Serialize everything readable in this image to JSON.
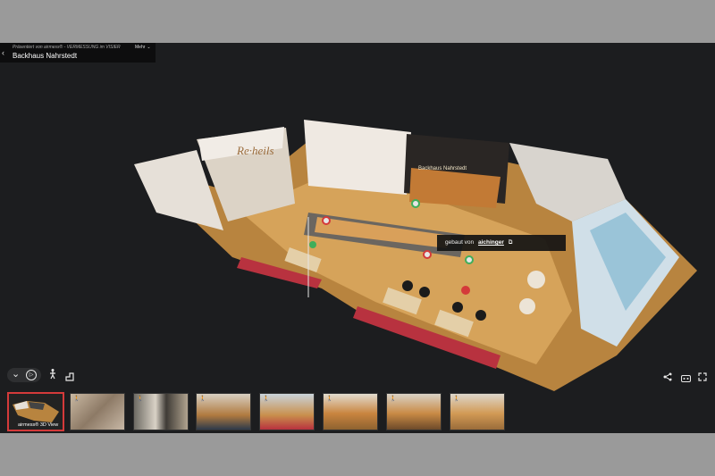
{
  "header": {
    "presented_by": "Präsentiert von airmess® - VERMESSUNG im VISIER",
    "menu_label": "Mehr",
    "title": "Backhaus Nahrstedt"
  },
  "credit": {
    "prefix": "gebaut von",
    "link": "aichinger",
    "ext_icon": "⧉"
  },
  "controls": {
    "collapse_icon": "⌄",
    "play_icon": "▷",
    "walk_icon": "🚶",
    "floorplan_icon": "⊑",
    "share_icon": "⋖",
    "vr_icon": "▭",
    "fullscreen_icon": "⤢"
  },
  "tour": {
    "thumbnails": [
      {
        "label": "airmess® 3D View"
      },
      {
        "label": ""
      },
      {
        "label": ""
      },
      {
        "label": ""
      },
      {
        "label": ""
      },
      {
        "label": ""
      },
      {
        "label": ""
      },
      {
        "label": ""
      }
    ]
  },
  "colors": {
    "viewer_bg": "#1c1d1f",
    "accent": "#d43a3a",
    "floor": "#c9964a"
  }
}
